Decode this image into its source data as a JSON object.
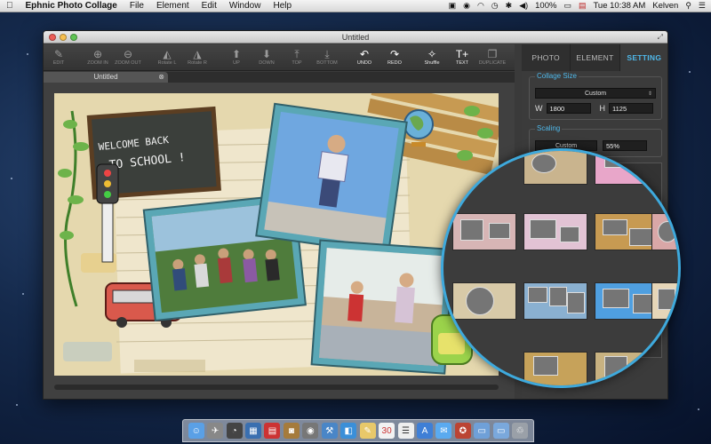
{
  "menubar": {
    "app_name": "Ephnic Photo Collage",
    "menus": [
      "File",
      "Element",
      "Edit",
      "Window",
      "Help"
    ],
    "battery": "100%",
    "clock": "Tue 10:38 AM",
    "user": "Kelven"
  },
  "window": {
    "title": "Untitled",
    "doc_tab": "Untitled",
    "toolbar": [
      {
        "label": "EDIT",
        "icon": "edit-icon",
        "enabled": false
      },
      {
        "label": "ZOOM IN",
        "icon": "zoom-in-icon",
        "enabled": false
      },
      {
        "label": "ZOOM OUT",
        "icon": "zoom-out-icon",
        "enabled": false
      },
      {
        "label": "Rotate L",
        "icon": "rotate-left-icon",
        "enabled": false
      },
      {
        "label": "Rotate R",
        "icon": "rotate-right-icon",
        "enabled": false
      },
      {
        "label": "UP",
        "icon": "arrow-up-icon",
        "enabled": false
      },
      {
        "label": "DOWN",
        "icon": "arrow-down-icon",
        "enabled": false
      },
      {
        "label": "TOP",
        "icon": "top-icon",
        "enabled": false
      },
      {
        "label": "BOTTOM",
        "icon": "bottom-icon",
        "enabled": false
      },
      {
        "label": "UNDO",
        "icon": "undo-icon",
        "enabled": true
      },
      {
        "label": "REDO",
        "icon": "redo-icon",
        "enabled": true
      },
      {
        "label": "Shuffle",
        "icon": "shuffle-icon",
        "enabled": true
      },
      {
        "label": "TEXT",
        "icon": "text-icon",
        "enabled": true
      },
      {
        "label": "DUPLICATE",
        "icon": "duplicate-icon",
        "enabled": false
      }
    ]
  },
  "panel": {
    "tabs": [
      "PHOTO",
      "ELEMENT",
      "SETTING"
    ],
    "active_tab": "SETTING",
    "collage_size_label": "Collage Size",
    "size_preset": "Custom",
    "w_label": "W",
    "w_value": "1800",
    "h_label": "H",
    "h_value": "1125",
    "scaling_label": "Scaling",
    "scaling_preset": "Custom",
    "scaling_value": "55%"
  },
  "collage": {
    "chalkboard_line1": "WELCOME BACK",
    "chalkboard_line2": "TO SCHOOL !"
  },
  "colors": {
    "accent": "#4fb8ea",
    "magnifier_border": "#3ea9dc",
    "photo_frame": "#5aa7b5"
  }
}
